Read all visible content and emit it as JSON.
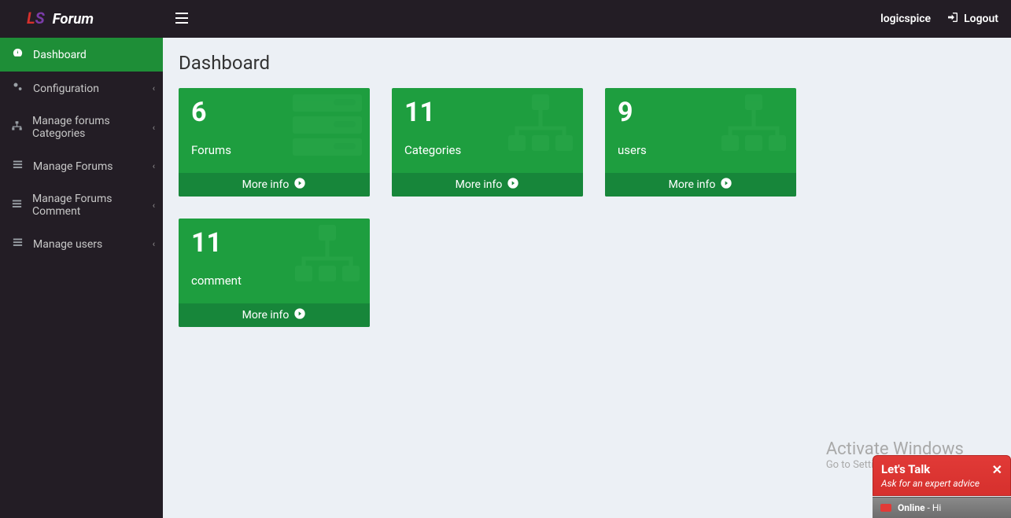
{
  "brand": {
    "ls": "LS",
    "forum": "Forum"
  },
  "topbar": {
    "username": "logicspice",
    "logout": "Logout"
  },
  "sidebar": {
    "items": [
      {
        "label": "Dashboard",
        "active": true,
        "expandable": false
      },
      {
        "label": "Configuration",
        "active": false,
        "expandable": true
      },
      {
        "label": "Manage forums Categories",
        "active": false,
        "expandable": true
      },
      {
        "label": "Manage Forums",
        "active": false,
        "expandable": true
      },
      {
        "label": "Manage Forums Comment",
        "active": false,
        "expandable": true
      },
      {
        "label": "Manage users",
        "active": false,
        "expandable": true
      }
    ]
  },
  "page": {
    "title": "Dashboard"
  },
  "stats": [
    {
      "value": "6",
      "label": "Forums",
      "link": "More info"
    },
    {
      "value": "11",
      "label": "Categories",
      "link": "More info"
    },
    {
      "value": "9",
      "label": "users",
      "link": "More info"
    },
    {
      "value": "11",
      "label": "comment",
      "link": "More info"
    }
  ],
  "watermark": {
    "line1": "Activate Windows",
    "line2": "Go to Settings to activate Windows."
  },
  "chat": {
    "title": "Let's Talk",
    "subtitle": "Ask for an expert advice",
    "status_label": "Online",
    "status_suffix": "- Hi"
  },
  "colors": {
    "accent": "#1e9e3f",
    "accent_dark": "#17863a",
    "sidebar_bg": "#231d25",
    "chat_red": "#e13a37"
  }
}
